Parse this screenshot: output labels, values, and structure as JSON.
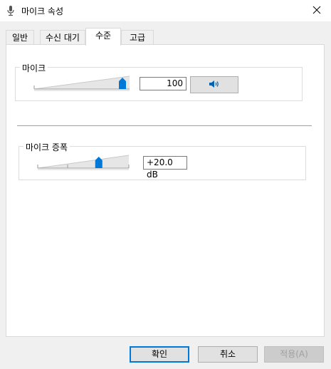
{
  "window": {
    "title": "마이크 속성",
    "icon": "microphone-icon",
    "close_icon": "close-icon"
  },
  "tabs": [
    {
      "label": "일반",
      "active": false
    },
    {
      "label": "수신 대기",
      "active": false
    },
    {
      "label": "수준",
      "active": true
    },
    {
      "label": "고급",
      "active": false
    }
  ],
  "mic": {
    "label": "마이크",
    "level": 100,
    "value_text": "100",
    "speaker_icon": "speaker-icon"
  },
  "boost": {
    "label": "마이크 증폭",
    "level_fraction": 0.67,
    "value_text": "+20.0 dB"
  },
  "buttons": {
    "ok": "확인",
    "cancel": "취소",
    "apply": "적용(A)"
  },
  "colors": {
    "accent": "#0078d7",
    "thumb": "#0078d7"
  }
}
